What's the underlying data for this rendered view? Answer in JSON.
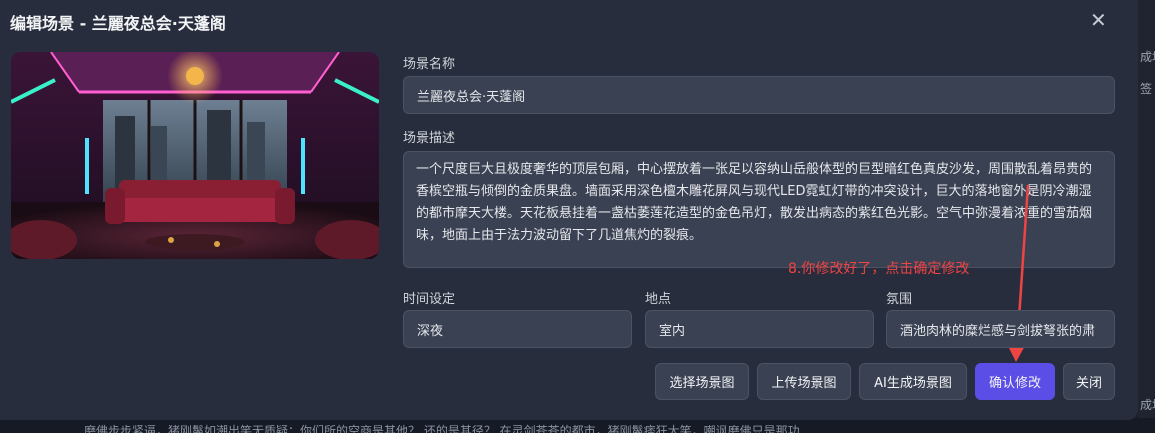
{
  "dialog": {
    "title": "编辑场景 - 兰麗夜总会·天蓬阁",
    "close_glyph": "✕"
  },
  "form": {
    "name_label": "场景名称",
    "name_value": "兰麗夜总会·天蓬阁",
    "desc_label": "场景描述",
    "desc_value": "一个尺度巨大且极度奢华的顶层包厢，中心摆放着一张足以容纳山岳般体型的巨型暗红色真皮沙发，周围散乱着昂贵的香槟空瓶与倾倒的金质果盘。墙面采用深色檀木雕花屏风与现代LED霓虹灯带的冲突设计，巨大的落地窗外是阴冷潮湿的都市摩天大楼。天花板悬挂着一盏枯萎莲花造型的金色吊灯，散发出病态的紫红色光影。空气中弥漫着浓重的雪茄烟味，地面上由于法力波动留下了几道焦灼的裂痕。",
    "time_label": "时间设定",
    "time_value": "深夜",
    "place_label": "地点",
    "place_value": "室内",
    "mood_label": "氛围",
    "mood_value": "酒池肉林的糜烂感与剑拔弩张的肃"
  },
  "annotation": {
    "text": "8.你修改好了，点击确定修改",
    "color": "#ef4444"
  },
  "buttons": {
    "select_image": "选择场景图",
    "upload_image": "上传场景图",
    "ai_generate": "AI生成场景图",
    "confirm": "确认修改",
    "close": "关闭"
  },
  "background": {
    "edge_texts": [
      "成场",
      "签",
      "成场"
    ],
    "bottom_text": "磨佛步步紧逼，猪刚鬣如潮出笑无质疑：你们所的空商是其他？ 还的是其径？ 在灵剑苍苍的都市，猪刚鬣痞狂大笑，嘲讽磨佛只是那功"
  },
  "colors": {
    "accent": "#5b4ee6",
    "modal_bg": "#272d3c",
    "field_bg": "#3a4152"
  }
}
